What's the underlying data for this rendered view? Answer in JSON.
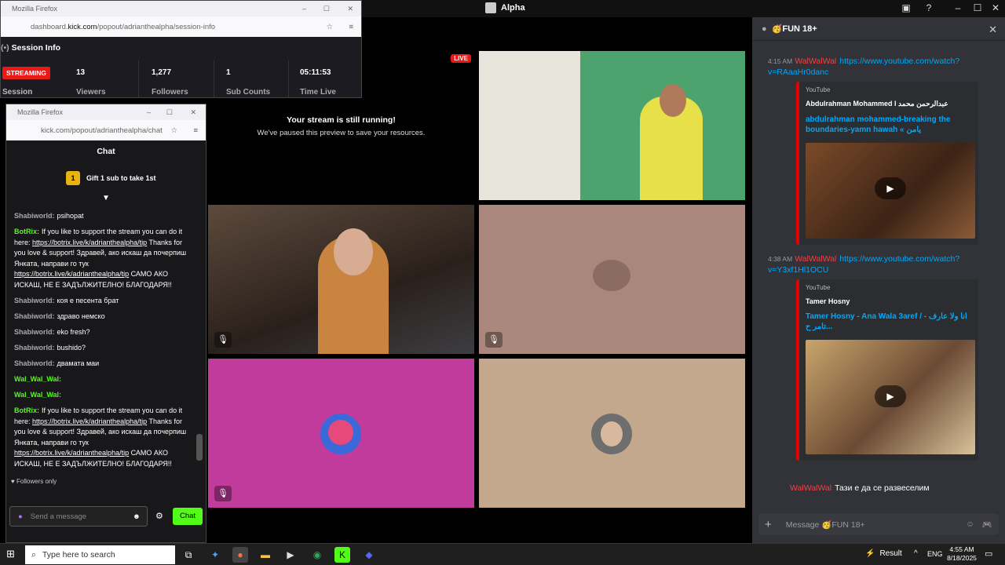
{
  "window_title": "Alpha",
  "discord": {
    "channel": "🥳FUN 18+",
    "messages": [
      {
        "time": "4:15 AM",
        "user": "WalWalWal",
        "link": "https://www.youtube.com/watch?v=RAaaHr0danc",
        "embed": {
          "provider": "YouTube",
          "author": "Abdulrahman Mohammed l عبدالرحمن محمد",
          "title": "abdulrahman mohammed-breaking the boundaries-yamn hawah « يامن"
        }
      },
      {
        "time": "4:38 AM",
        "user": "WalWalWal",
        "link": "https://www.youtube.com/watch?v=Y3xf1Hl1OCU",
        "embed": {
          "provider": "YouTube",
          "author": "Tamer Hosny",
          "title": "Tamer Hosny - Ana Wala 3aref / انا ولا عارف - تامر ح..."
        }
      },
      {
        "user": "WalWalWal",
        "text": "Тази е да се развеселим"
      }
    ],
    "input_placeholder": "Message 🥳FUN 18+"
  },
  "stream": {
    "live_badge": "LIVE",
    "notice_title": "Your stream is still running!",
    "notice_sub": "We've paused this preview to save your resources."
  },
  "session_popup": {
    "titlebar": "Mozilla Firefox",
    "url_prefix": "dashboard.",
    "url_domain": "kick.com",
    "url_path": "/popout/adrianthealpha/session-info",
    "heading": "Session Info",
    "status": "STREAMING",
    "session_label": "Session",
    "stats": [
      {
        "value": "13",
        "label": "Viewers"
      },
      {
        "value": "1,277",
        "label": "Followers"
      },
      {
        "value": "1",
        "label": "Sub Counts"
      },
      {
        "value": "05:11:53",
        "label": "Time Live"
      }
    ]
  },
  "chat_popup": {
    "titlebar": "Mozilla Firefox",
    "url": "kick.com/popout/adrianthealpha/chat",
    "heading": "Chat",
    "gift_badge": "1",
    "gift_text": "Gift 1 sub to take 1st",
    "lines": [
      {
        "user": "Shabiworld:",
        "text": "psihopat"
      },
      {
        "user": "BotRix:",
        "text": "If you like to support the stream you can do it here: ",
        "link": "https://botrix.live/k/adrianthealpha/tip",
        "text2": " Thanks for you love & support! Здравей, ако искаш да почерпиш Янката, направи го тук ",
        "link2": "https://botrix.live/k/adrianthealpha/tip",
        "text3": " САМО АКО ИСКАШ, НЕ Е ЗАДЪЛЖИТЕЛНО! БЛАГОДАРЯ!!"
      },
      {
        "user": "Shabiworld:",
        "text": "коя е песента брат"
      },
      {
        "user": "Shabiworld:",
        "text": "здраво немско"
      },
      {
        "user": "Shabiworld:",
        "text": "eko fresh?"
      },
      {
        "user": "Shabiworld:",
        "text": "bushido?"
      },
      {
        "user": "Shabiworld:",
        "text": "двамата маи"
      },
      {
        "user": "Wal_Wal_Wal:",
        "text": ""
      },
      {
        "user": "Wal_Wal_Wal:",
        "text": ""
      },
      {
        "user": "BotRix:",
        "text": "If you like to support the stream you can do it here: ",
        "link": "https://botrix.live/k/adrianthealpha/tip",
        "text2": " Thanks for you love & support! Здравей, ако искаш да почерпиш Янката, направи го тук ",
        "link2": "https://botrix.live/k/adrianthealpha/tip",
        "text3": " САМО АКО ИСКАШ, НЕ Е ЗАДЪЛЖИТЕЛНО! БЛАГОДАРЯ!!"
      }
    ],
    "followers_only": "Followers only",
    "input_placeholder": "Send a message",
    "send_button": "Chat"
  },
  "taskbar": {
    "search_placeholder": "Type here to search",
    "result_label": "Result",
    "lang": "ENG",
    "time": "4:55 AM",
    "date": "8/18/2025"
  }
}
